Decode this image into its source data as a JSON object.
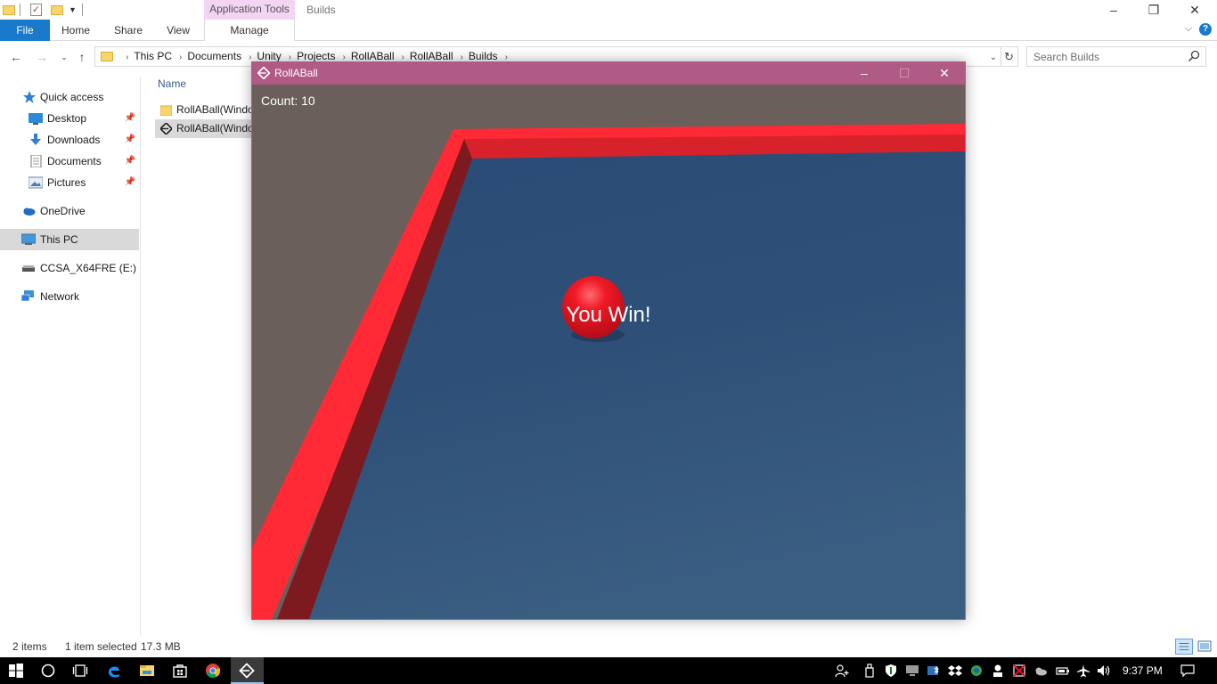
{
  "explorer": {
    "context_tab": "Application Tools",
    "window_title": "Builds",
    "ribbon_tabs": {
      "file": "File",
      "home": "Home",
      "share": "Share",
      "view": "View",
      "manage": "Manage"
    },
    "breadcrumbs": [
      "This PC",
      "Documents",
      "Unity",
      "Projects",
      "RollABall",
      "RollABall",
      "Builds"
    ],
    "search": {
      "placeholder": "Search Builds"
    },
    "nav_items": {
      "quick_access": "Quick access",
      "desktop": "Desktop",
      "downloads": "Downloads",
      "documents": "Documents",
      "pictures": "Pictures",
      "onedrive": "OneDrive",
      "this_pc": "This PC",
      "drive": "CCSA_X64FRE (E:)",
      "network": "Network"
    },
    "column_header": "Name",
    "files": [
      {
        "name": "RollABall(Windo"
      },
      {
        "name": "RollABall(Windo"
      }
    ],
    "status": {
      "count": "2 items",
      "selected": "1 item selected",
      "size": "17.3 MB"
    }
  },
  "game": {
    "title": "RollABall",
    "count_text": "Count: 10",
    "win_text": "You Win!"
  },
  "taskbar": {
    "clock": "9:37 PM"
  },
  "colors": {
    "file_tab": "#1979ca",
    "context_tab_bg": "#f3d4f3",
    "game_titlebar": "#b05a86",
    "floor": "#2e5078",
    "wall": "#ff2a35",
    "ball": "#e8111f",
    "taskbar": "#000000"
  }
}
